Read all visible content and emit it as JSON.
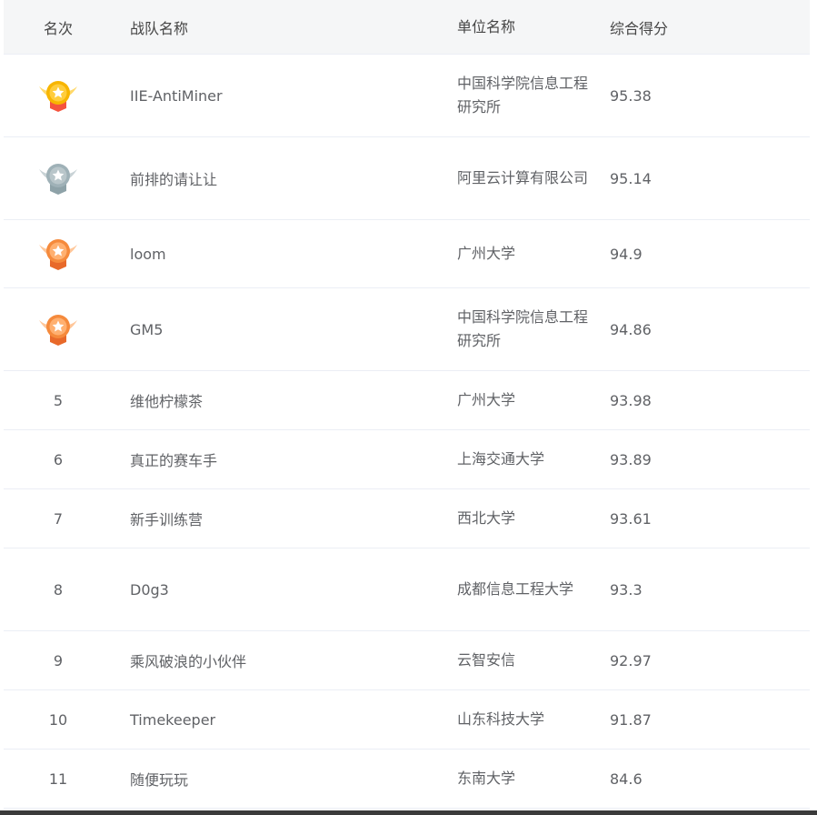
{
  "header": {
    "rank": "名次",
    "team": "战队名称",
    "org": "单位名称",
    "score": "综合得分"
  },
  "colors": {
    "gold": "#f7b500",
    "silver": "#9fb1b7",
    "bronze": "#f58a3c",
    "header_bg": "#f5f6f7",
    "divider": "#ebeef5"
  },
  "rows": [
    {
      "rank": "1",
      "medal": "gold-medal-icon",
      "team": "IIE-AntiMiner",
      "org": "中国科学院信息工程研究所",
      "score": "95.38"
    },
    {
      "rank": "2",
      "medal": "silver-medal-icon",
      "team": "前排的请让让",
      "org": "阿里云计算有限公司",
      "score": "95.14"
    },
    {
      "rank": "3",
      "medal": "bronze-medal-icon",
      "team": "loom",
      "org": "广州大学",
      "score": "94.9"
    },
    {
      "rank": "4",
      "medal": "bronze-medal-icon",
      "team": "GM5",
      "org": "中国科学院信息工程研究所",
      "score": "94.86"
    },
    {
      "rank": "5",
      "team": "维他柠檬茶",
      "org": "广州大学",
      "score": "93.98"
    },
    {
      "rank": "6",
      "team": "真正的赛车手",
      "org": "上海交通大学",
      "score": "93.89"
    },
    {
      "rank": "7",
      "team": "新手训练营",
      "org": "西北大学",
      "score": "93.61"
    },
    {
      "rank": "8",
      "team": "D0g3",
      "org": "成都信息工程大学",
      "score": "93.3"
    },
    {
      "rank": "9",
      "team": "乘风破浪的小伙伴",
      "org": "云智安信",
      "score": "92.97"
    },
    {
      "rank": "10",
      "team": "Timekeeper",
      "org": "山东科技大学",
      "score": "91.87"
    },
    {
      "rank": "11",
      "team": "随便玩玩",
      "org": "东南大学",
      "score": "84.6"
    }
  ]
}
